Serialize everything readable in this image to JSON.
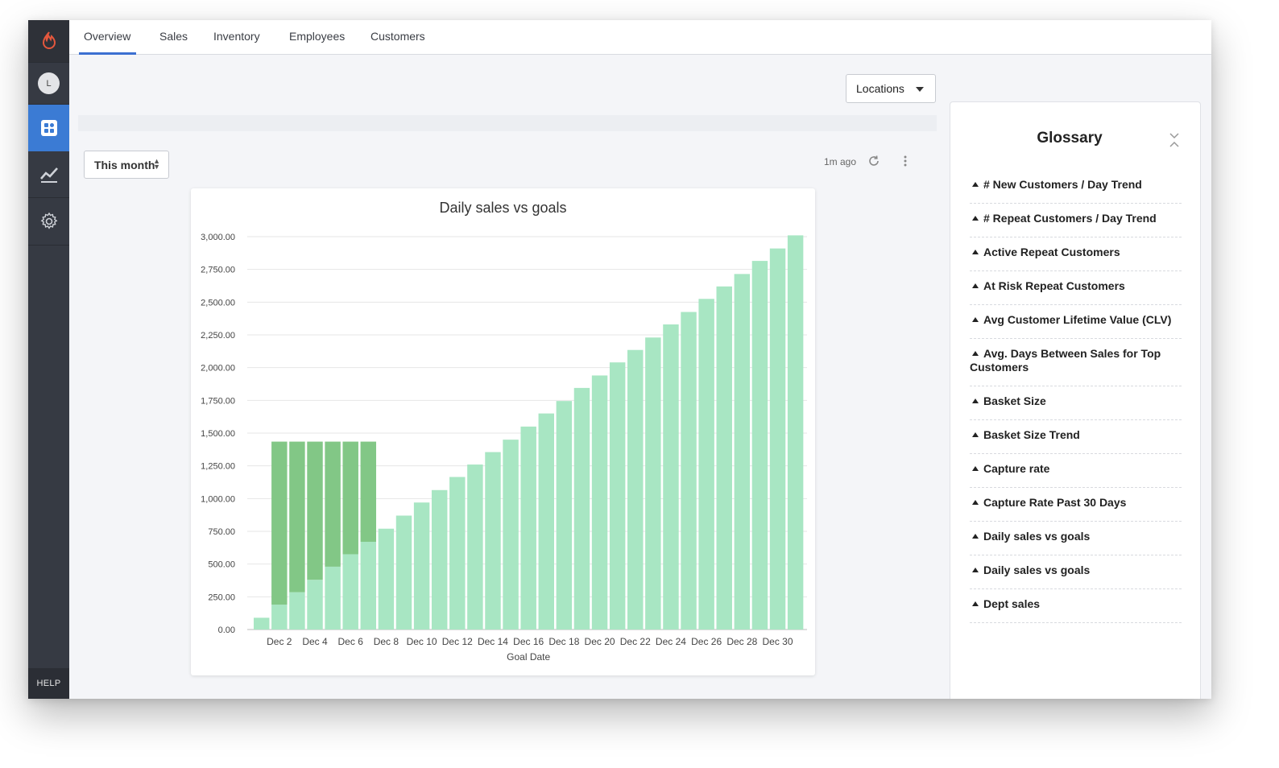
{
  "sidebar": {
    "avatar_initial": "L",
    "help_label": "HELP"
  },
  "nav": {
    "tabs": [
      {
        "label": "Overview",
        "active": true
      },
      {
        "label": "Sales",
        "active": false
      },
      {
        "label": "Inventory",
        "active": false
      },
      {
        "label": "Employees",
        "active": false
      },
      {
        "label": "Customers",
        "active": false
      }
    ]
  },
  "toolbar": {
    "locations_label": "Locations",
    "period_label": "This month",
    "updated_label": "1m ago"
  },
  "colors": {
    "accent": "#3b7bd4",
    "bar_actual": "#a8e6c3",
    "bar_goal": "#82c786",
    "sidebar": "#363a43"
  },
  "chart_data": {
    "type": "bar",
    "stacked": true,
    "title": "Daily sales vs goals",
    "xlabel": "Goal Date",
    "ylabel": "",
    "ylim": [
      0,
      3000
    ],
    "yticks": [
      "0.00",
      "250.00",
      "500.00",
      "750.00",
      "1,000.00",
      "1,250.00",
      "1,500.00",
      "1,750.00",
      "2,000.00",
      "2,250.00",
      "2,500.00",
      "2,750.00",
      "3,000.00"
    ],
    "xticks": [
      "Dec 2",
      "Dec 4",
      "Dec 6",
      "Dec 8",
      "Dec 10",
      "Dec 12",
      "Dec 14",
      "Dec 16",
      "Dec 18",
      "Dec 20",
      "Dec 22",
      "Dec 24",
      "Dec 26",
      "Dec 28",
      "Dec 30"
    ],
    "categories": [
      "Dec 1",
      "Dec 2",
      "Dec 3",
      "Dec 4",
      "Dec 5",
      "Dec 6",
      "Dec 7",
      "Dec 8",
      "Dec 9",
      "Dec 10",
      "Dec 11",
      "Dec 12",
      "Dec 13",
      "Dec 14",
      "Dec 15",
      "Dec 16",
      "Dec 17",
      "Dec 18",
      "Dec 19",
      "Dec 20",
      "Dec 21",
      "Dec 22",
      "Dec 23",
      "Dec 24",
      "Dec 25",
      "Dec 26",
      "Dec 27",
      "Dec 28",
      "Dec 29",
      "Dec 30",
      "Dec 31"
    ],
    "series": [
      {
        "values": [
          90,
          190,
          285,
          380,
          480,
          575,
          670,
          770,
          870,
          970,
          1065,
          1165,
          1260,
          1355,
          1450,
          1550,
          1650,
          1745,
          1845,
          1940,
          2040,
          2135,
          2230,
          2330,
          2425,
          2525,
          2620,
          2715,
          2815,
          2910,
          3010
        ]
      },
      {
        "values": [
          0,
          1245,
          1150,
          1055,
          955,
          860,
          765,
          0,
          0,
          0,
          0,
          0,
          0,
          0,
          0,
          0,
          0,
          0,
          0,
          0,
          0,
          0,
          0,
          0,
          0,
          0,
          0,
          0,
          0,
          0,
          0
        ]
      }
    ]
  },
  "glossary": {
    "title": "Glossary",
    "items": [
      "# New Customers / Day Trend",
      "# Repeat Customers / Day Trend",
      "Active Repeat Customers",
      "At Risk Repeat Customers",
      "Avg Customer Lifetime Value (CLV)",
      "Avg. Days Between Sales for Top Customers",
      "Basket Size",
      "Basket Size Trend",
      "Capture rate",
      "Capture Rate Past 30 Days",
      "Daily sales vs goals",
      "Daily sales vs goals",
      "Dept sales"
    ]
  }
}
